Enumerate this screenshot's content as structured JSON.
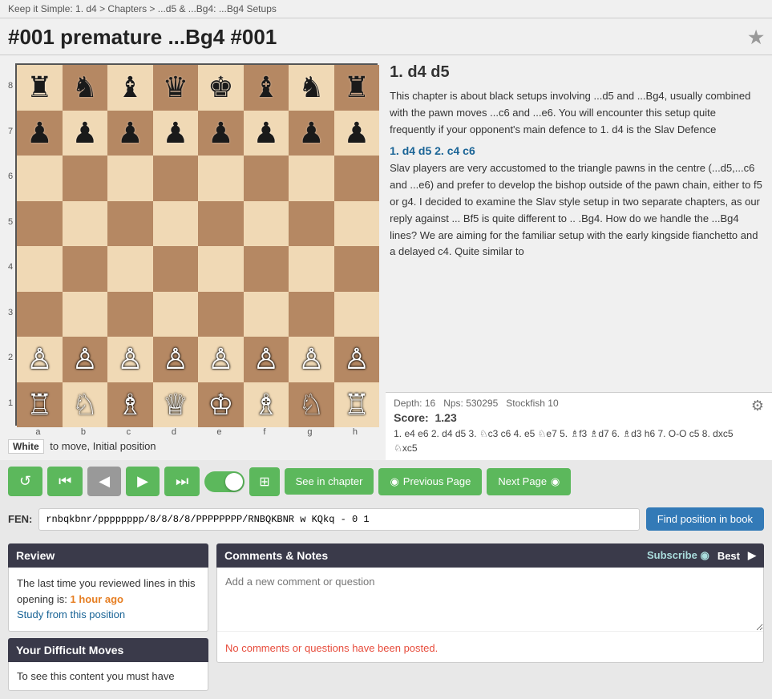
{
  "nav": {
    "breadcrumb": "Keep it Simple: 1. d4  >  Chapters  >  ...d5 & ...Bg4: ...Bg4 Setups"
  },
  "page": {
    "title": "#001 premature ...Bg4 #001",
    "bookmark_icon": "★"
  },
  "content": {
    "move_header": "1. d4  d5",
    "paragraph1": "This chapter is about black setups involving ...d5 and ...Bg4, usually combined with the pawn moves ...c6 and ...e6. You will encounter this setup quite frequently if your opponent's main defence to 1. d4 is the Slav Defence",
    "move_line_1": "1. d4 d5  2. c4 c6",
    "paragraph2": "Slav players are very accustomed to the triangle pawns in the centre (...d5,...c6 and ...e6) and prefer to develop the bishop outside of the pawn chain, either to f5 or g4. I decided to examine the Slav style setup in two separate chapters, as our reply against ... Bf5 is quite different to .. .Bg4. How do we handle the ...Bg4 lines? We are aiming for the familiar setup with the early kingside fianchetto and a delayed c4. Quite similar to"
  },
  "engine": {
    "depth_label": "Depth: 16",
    "nps_label": "Nps: 530295",
    "engine_name": "Stockfish 10",
    "score_label": "Score:",
    "score_value": "1.23",
    "moves": "1. e4 e6 2. d4 d5 3. ♘c3 c6 4. e5 ♘e7 5. ♗f3 ♗d7 6. ♗d3 h6 7. O-O c5 8. dxc5 ♘xc5"
  },
  "controls": {
    "reset_icon": "↺",
    "start_icon": "⏮",
    "prev_icon": "◀",
    "next_icon": "▶",
    "end_icon": "⏭",
    "board_icon": "⊞",
    "see_chapter": "See in chapter",
    "prev_page": "Previous Page",
    "next_page": "Next Page"
  },
  "fen": {
    "label": "FEN:",
    "value": "rnbqkbnr/pppppppp/8/8/8/8/PPPPPPPP/RNBQKBNR w KQkq - 0 1",
    "find_button": "Find position in book"
  },
  "board_status": {
    "white_label": "White",
    "status_text": "to move, Initial position"
  },
  "review": {
    "header": "Review",
    "text": "The last time you reviewed lines in this opening is:",
    "time": "1 hour ago",
    "link": "Study from this position"
  },
  "difficult": {
    "header": "Your Difficult Moves",
    "text": "To see this content you must have"
  },
  "comments": {
    "header": "Comments & Notes",
    "subscribe_label": "Subscribe",
    "rss_icon": "◉",
    "best_label": "Best",
    "chevron_right": "▶",
    "placeholder": "Add a new comment or question",
    "no_comments": "No comments or questions have been posted."
  },
  "board": {
    "ranks": [
      "8",
      "7",
      "6",
      "5",
      "4",
      "3",
      "2",
      "1"
    ],
    "files": [
      "a",
      "b",
      "c",
      "d",
      "e",
      "f",
      "g",
      "h"
    ],
    "pieces": {
      "8": {
        "a": "♜",
        "b": "♞",
        "c": "♝",
        "d": "♛",
        "e": "♚",
        "f": "♝",
        "g": "♞",
        "h": "♜"
      },
      "7": {
        "a": "♟",
        "b": "♟",
        "c": "♟",
        "d": "♟",
        "e": "♟",
        "f": "♟",
        "g": "♟",
        "h": "♟"
      },
      "6": {},
      "5": {},
      "4": {},
      "3": {},
      "2": {
        "a": "♙",
        "b": "♙",
        "c": "♙",
        "d": "♙",
        "e": "♙",
        "f": "♙",
        "g": "♙",
        "h": "♙"
      },
      "1": {
        "a": "♖",
        "b": "♘",
        "c": "♗",
        "d": "♕",
        "e": "♔",
        "f": "♗",
        "g": "♘",
        "h": "♖"
      }
    }
  }
}
